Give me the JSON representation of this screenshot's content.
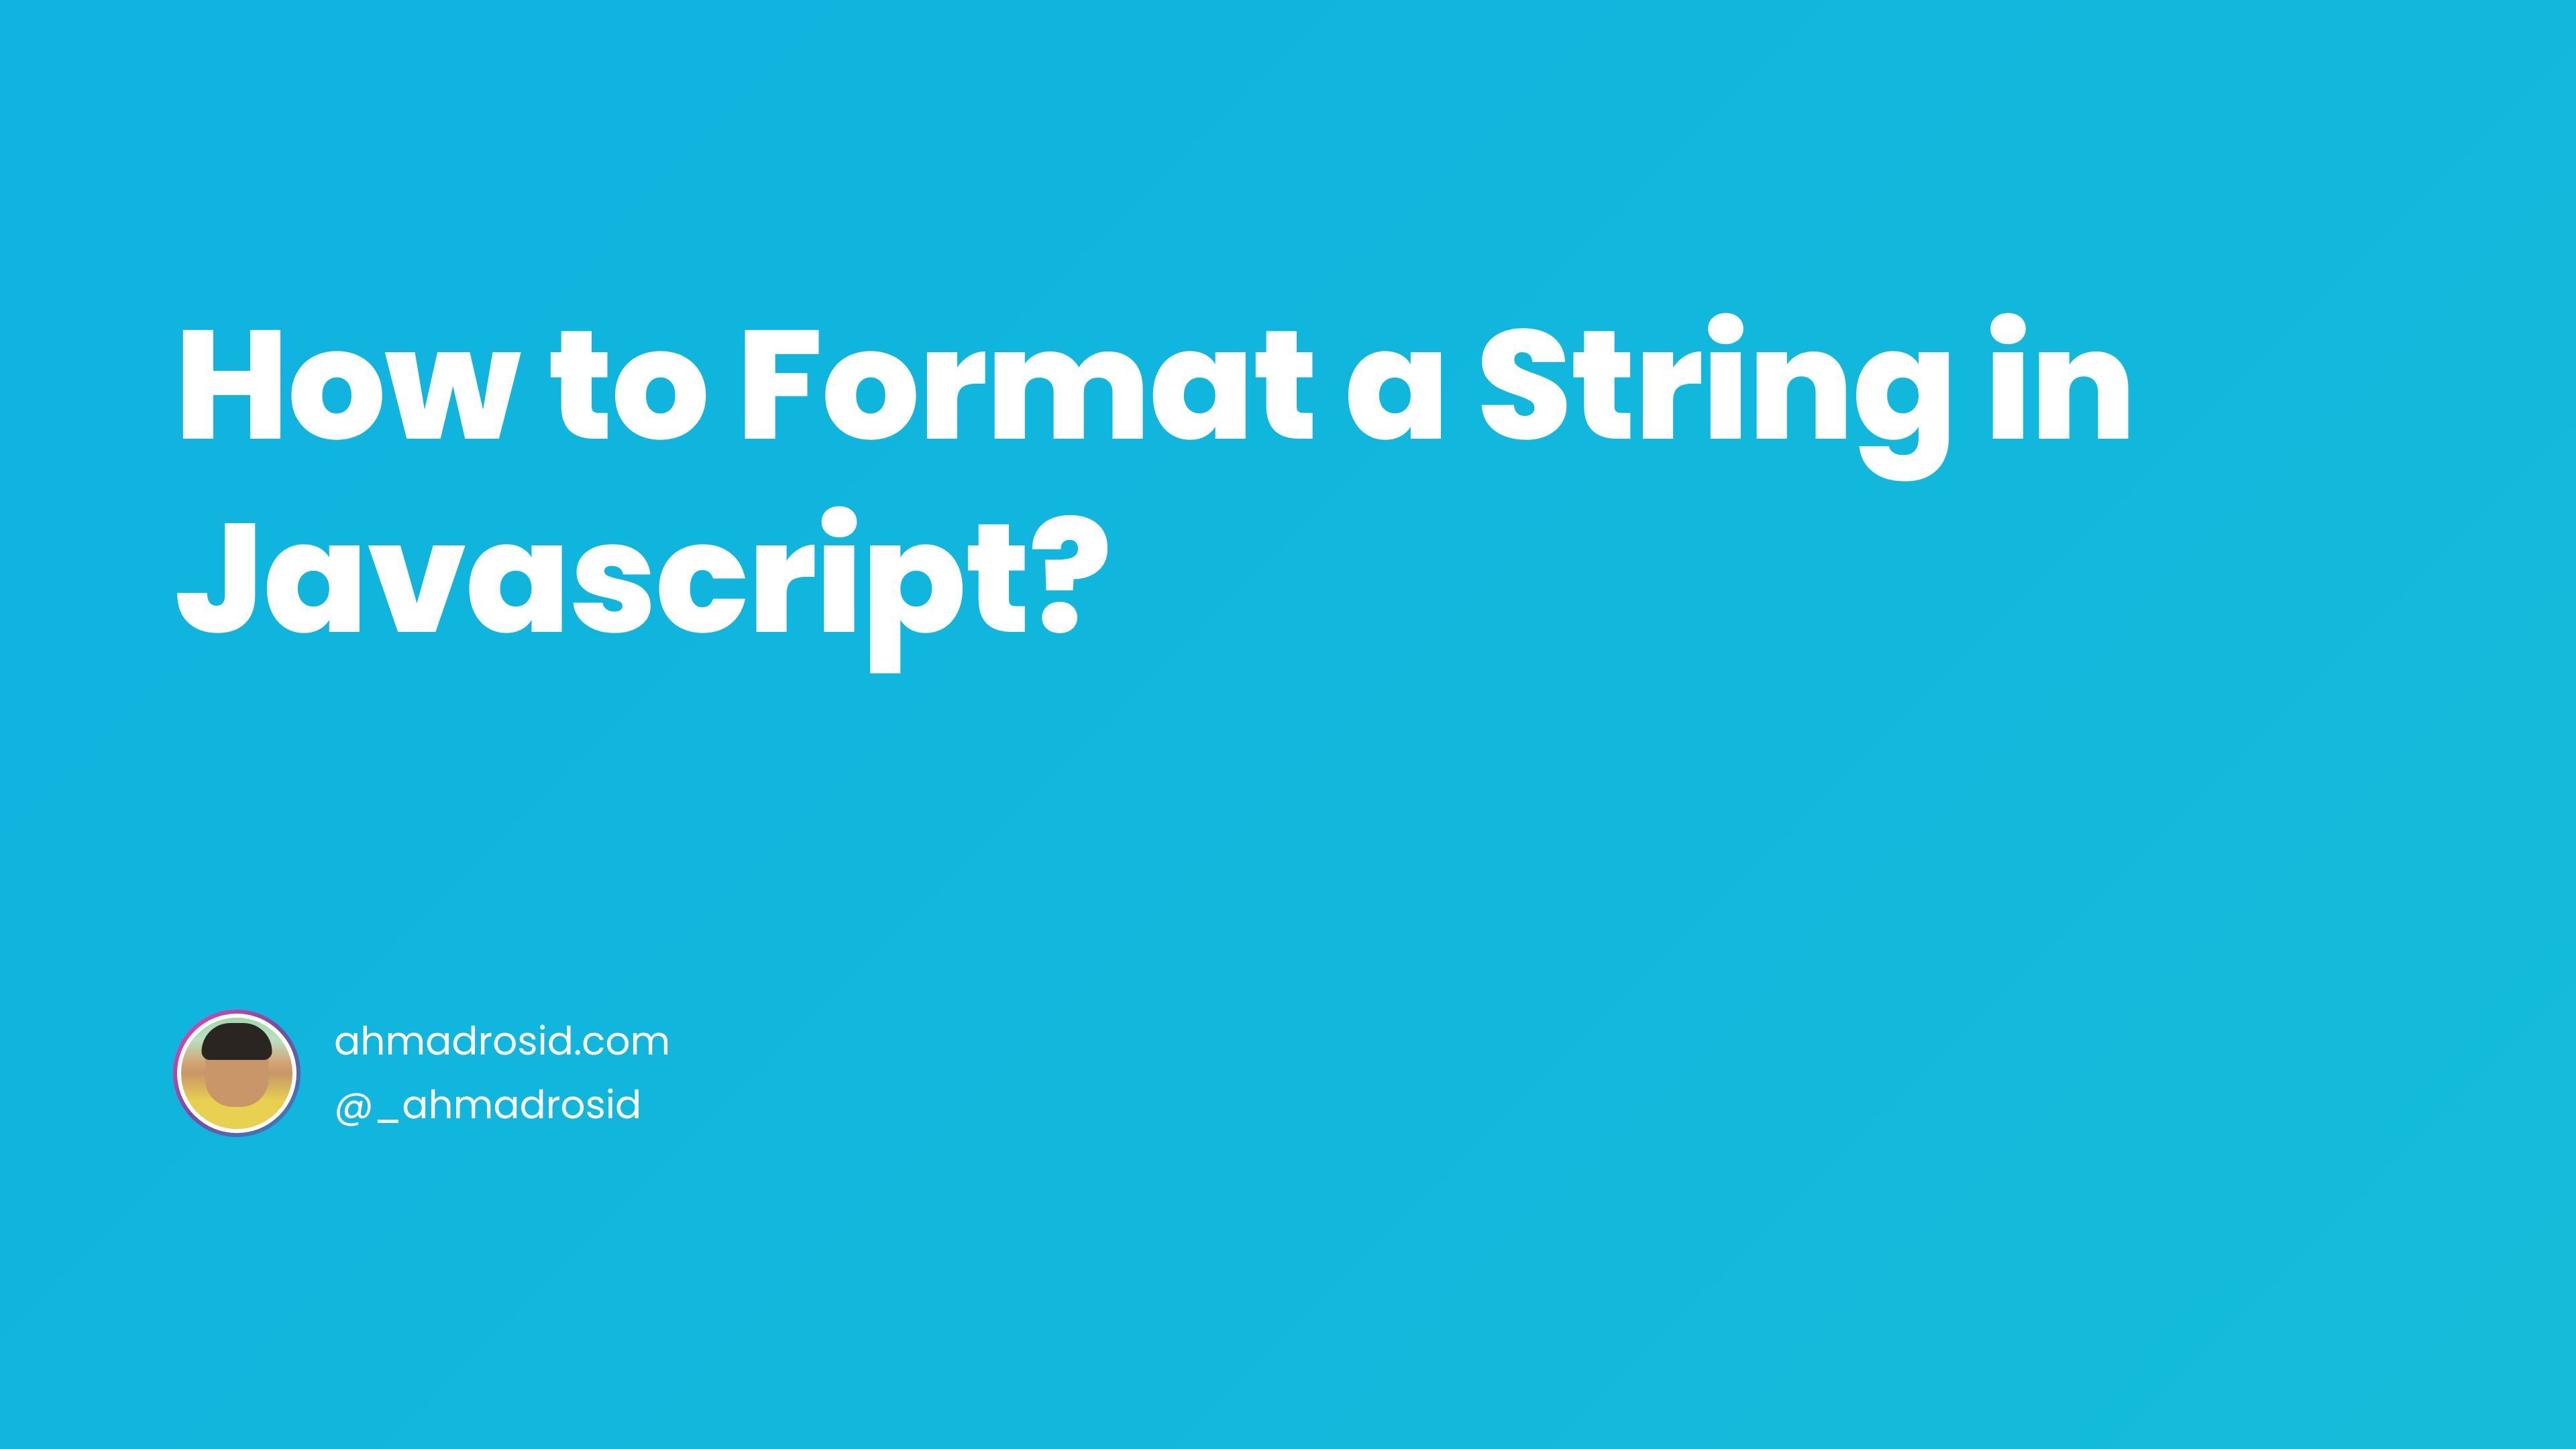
{
  "title": "How to Format a String in Javascript?",
  "author": {
    "website": "ahmadrosid.com",
    "handle": "@_ahmadrosid"
  }
}
